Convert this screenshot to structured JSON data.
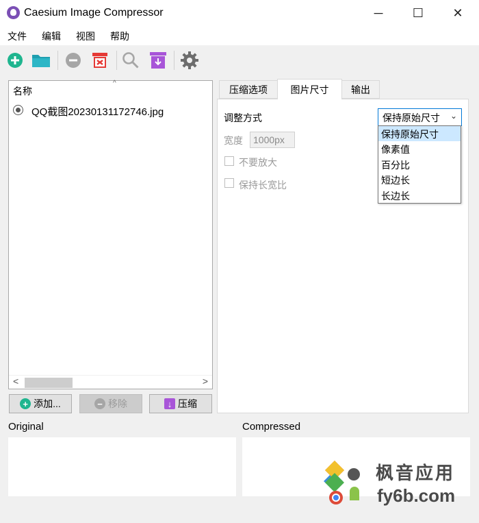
{
  "window": {
    "title": "Caesium Image Compressor",
    "minimize_glyph": "─",
    "maximize_glyph": "☐",
    "close_glyph": "✕"
  },
  "menu": [
    "文件",
    "编辑",
    "视图",
    "帮助"
  ],
  "toolbar": {
    "icons": [
      "add-icon",
      "open-folder-icon",
      "remove-icon",
      "clear-icon",
      "search-icon",
      "compress-icon",
      "settings-icon"
    ]
  },
  "file_list": {
    "column_header": "名称",
    "sort_glyph": "^",
    "files": [
      "QQ截图20230131172746.jpg"
    ]
  },
  "buttons": {
    "add": "添加...",
    "remove": "移除",
    "compress": "压缩"
  },
  "tabs": [
    {
      "label": "压缩选项",
      "active": false
    },
    {
      "label": "图片尺寸",
      "active": true
    },
    {
      "label": "输出",
      "active": false
    }
  ],
  "resize": {
    "mode_label": "调整方式",
    "mode_selected": "保持原始尺寸",
    "mode_options": [
      "保持原始尺寸",
      "像素值",
      "百分比",
      "短边长",
      "长边长"
    ],
    "width_label": "宽度",
    "width_value": "1000px",
    "no_upscale_label": "不要放大",
    "keep_ratio_label": "保持长宽比"
  },
  "preview": {
    "original_label": "Original",
    "compressed_label": "Compressed"
  },
  "watermark": {
    "line1": "枫音应用",
    "line2": "fy6b.com"
  },
  "colors": {
    "accent_green": "#1fb58f",
    "folder_teal": "#1f9fb0",
    "delete_red": "#e53935",
    "compress_purple": "#a855d8",
    "disabled_gray": "#9a9a9a",
    "selection_blue": "#cce8ff",
    "focus_blue": "#0078d7"
  }
}
